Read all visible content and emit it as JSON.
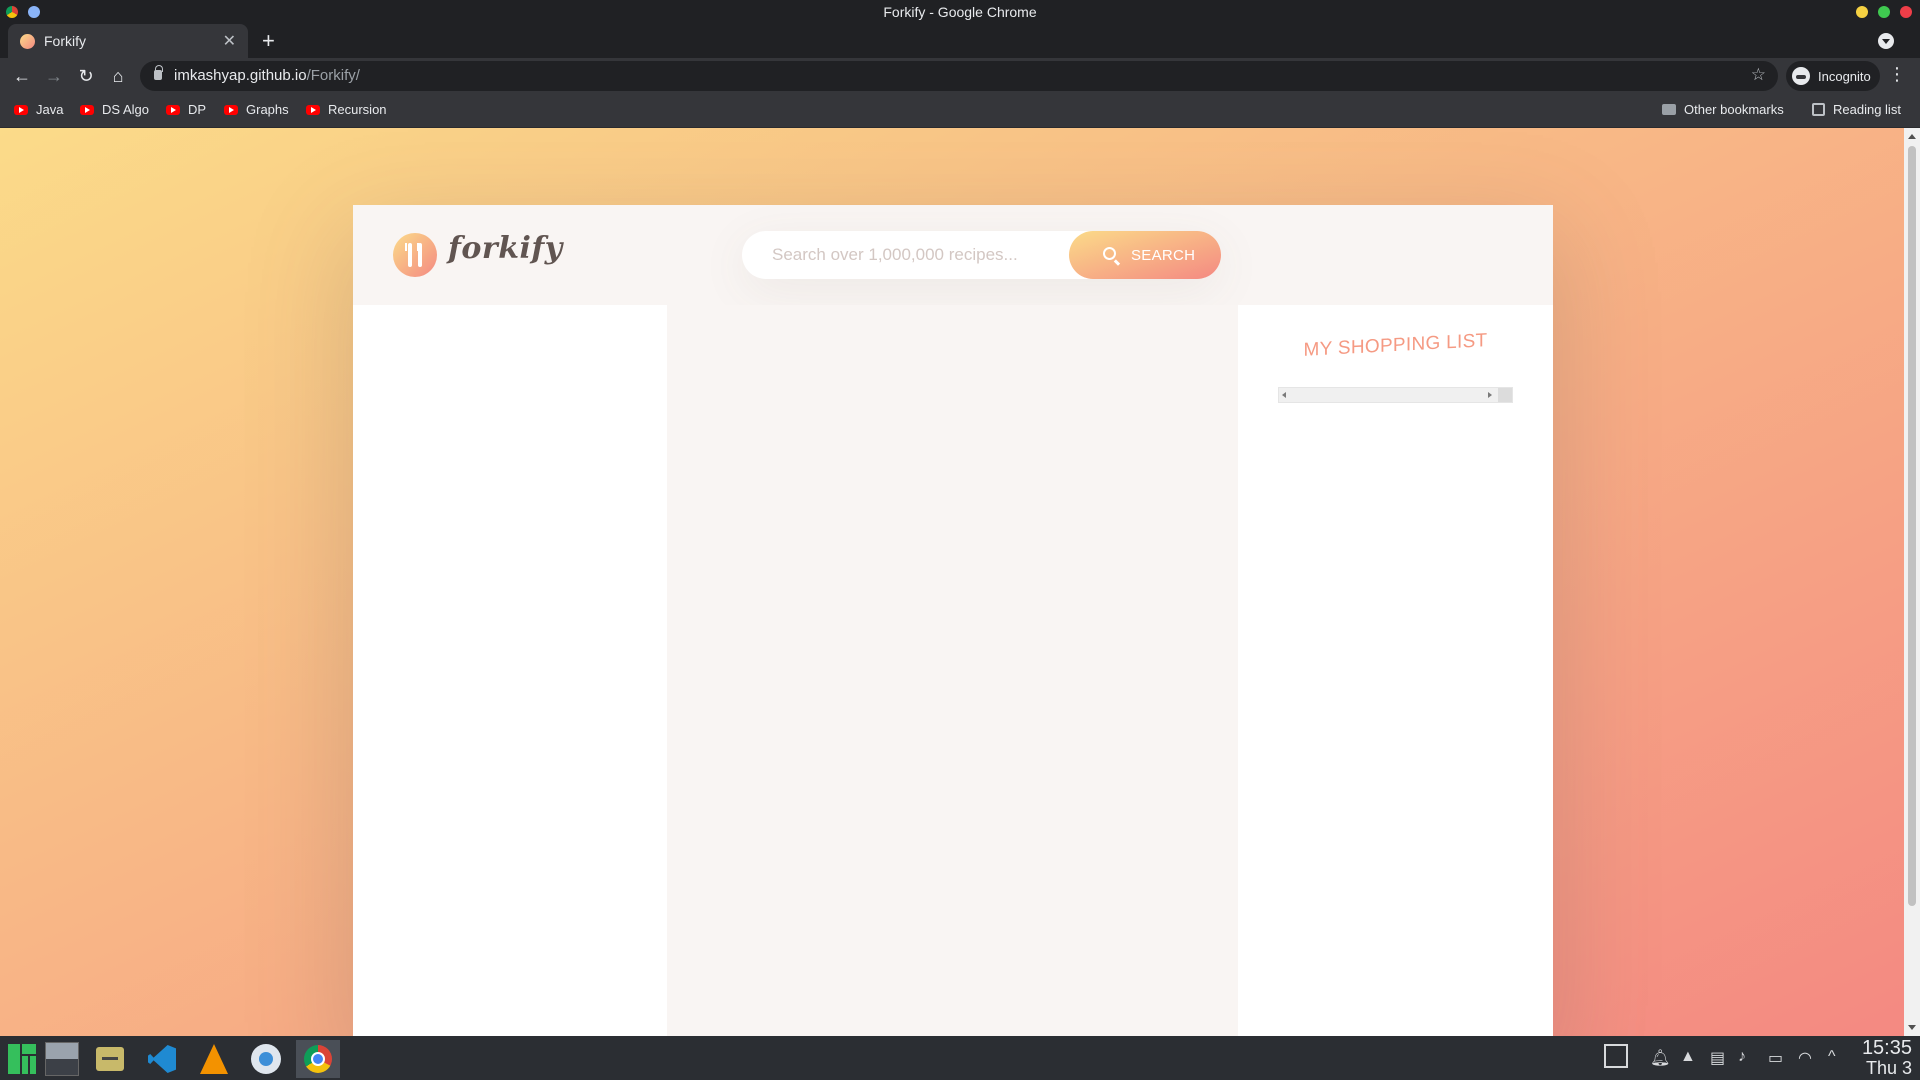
{
  "window": {
    "title": "Forkify - Google Chrome"
  },
  "tabs": [
    {
      "label": "Forkify",
      "close": "✕"
    }
  ],
  "toolbar": {
    "url_host": "imkashyap.github.io",
    "url_path": "/Forkify/",
    "incognito_label": "Incognito"
  },
  "bookmarks": {
    "items": [
      {
        "label": "Java"
      },
      {
        "label": "DS Algo"
      },
      {
        "label": "DP"
      },
      {
        "label": "Graphs"
      },
      {
        "label": "Recursion"
      }
    ],
    "other": "Other bookmarks",
    "reading_list": "Reading list"
  },
  "app": {
    "brand": "forkify",
    "search_placeholder": "Search over 1,000,000 recipes...",
    "search_button": "SEARCH",
    "shopping_title": "MY SHOPPING LIST",
    "colors": {
      "gradient_start": "#fbdb89",
      "gradient_end": "#f48982",
      "text": "#615551"
    }
  },
  "taskbar": {
    "apps": [
      "manjaro-menu-icon",
      "show-desktop-icon",
      "file-manager-icon",
      "vscode-icon",
      "vlc-icon",
      "kde-connect-icon",
      "chrome-icon"
    ],
    "clock_time": "15:35",
    "clock_day": "Thu 3"
  }
}
